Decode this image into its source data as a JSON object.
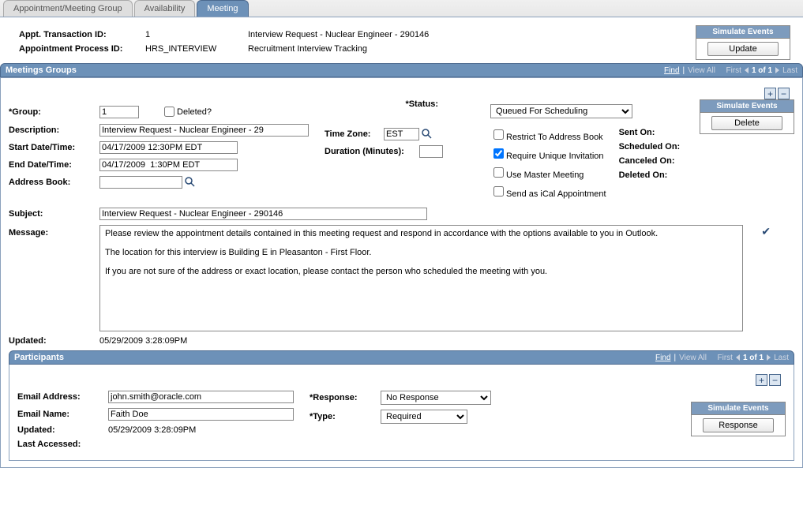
{
  "tabs": {
    "group": "Appointment/Meeting Group",
    "availability": "Availability",
    "meeting": "Meeting"
  },
  "top": {
    "txn_label": "Appt. Transaction ID:",
    "txn_value": "1",
    "txn_desc": "Interview Request - Nuclear Engineer - 290146",
    "proc_label": "Appointment Process ID:",
    "proc_value": "HRS_INTERVIEW",
    "proc_desc": "Recruitment Interview Tracking"
  },
  "simulate": {
    "title": "Simulate Events",
    "update": "Update",
    "delete": "Delete",
    "response": "Response"
  },
  "groups_header": "Meetings Groups",
  "nav": {
    "find": "Find",
    "viewall": "View All",
    "first": "First",
    "count": "1 of 1",
    "last": "Last"
  },
  "form": {
    "group_label": "Group:",
    "group_value": "1",
    "deleted_label": "Deleted?",
    "status_label": "Status:",
    "status_value": "Queued For Scheduling",
    "desc_label": "Description:",
    "desc_value": "Interview Request - Nuclear Engineer - 29",
    "start_label": "Start Date/Time:",
    "start_value": "04/17/2009 12:30PM EDT",
    "end_label": "End Date/Time:",
    "end_value": "04/17/2009  1:30PM EDT",
    "tz_label": "Time Zone:",
    "tz_value": "EST",
    "dur_label": "Duration (Minutes):",
    "dur_value": "",
    "ab_label": "Address Book:",
    "ab_value": "",
    "subj_label": "Subject:",
    "subj_value": "Interview Request - Nuclear Engineer - 290146",
    "msg_label": "Message:",
    "msg_value": "Please review the appointment details contained in this meeting request and respond in accordance with the options available to you in Outlook.\n\nThe location for this interview is Building E in Pleasanton - First Floor.\n\nIf you are not sure of the address or exact location, please contact the person who scheduled the meeting with you.",
    "restrict_label": "Restrict To Address Book",
    "unique_label": "Require Unique Invitation",
    "master_label": "Use Master Meeting",
    "ical_label": "Send as iCal Appointment",
    "sent_label": "Sent On:",
    "sched_label": "Scheduled On:",
    "cancel_label": "Canceled On:",
    "deleted_on_label": "Deleted On:",
    "updated_label": "Updated:",
    "updated_value": "05/29/2009  3:28:09PM"
  },
  "participants_header": "Participants",
  "participant": {
    "email_label": "Email Address:",
    "email_value": "john.smith@oracle.com",
    "name_label": "Email Name:",
    "name_value": "Faith Doe",
    "updated_label": "Updated:",
    "updated_value": "05/29/2009  3:28:09PM",
    "last_label": "Last Accessed:",
    "response_label": "Response:",
    "response_value": "No Response",
    "type_label": "Type:",
    "type_value": "Required"
  }
}
